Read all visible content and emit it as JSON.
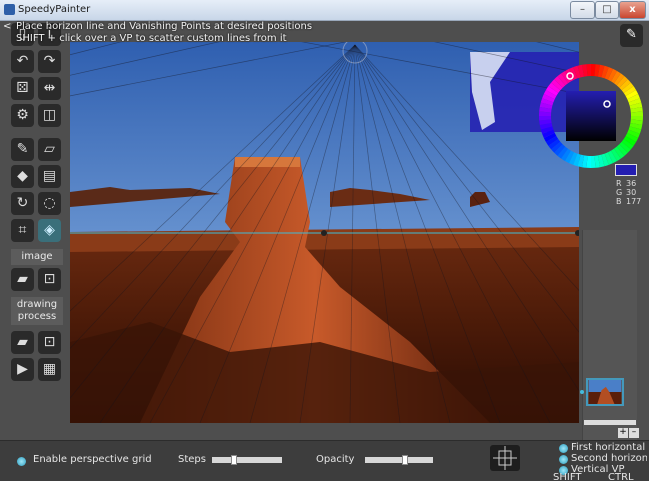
{
  "window": {
    "title": "SpeedyPainter",
    "minimize": "–",
    "maximize": "□",
    "close": "x"
  },
  "status": {
    "back": "<",
    "line1": "Place horizon line and Vanishing Points at desired positions",
    "line2": "SHIFT + click over a VP to scatter custom lines from it"
  },
  "toolbar": {
    "image_label": "image",
    "drawing_process_label": "drawing\nprocess",
    "icons": [
      "new-document-icon",
      "info-icon",
      "undo-icon",
      "redo-icon",
      "dice-icon",
      "mirror-icon",
      "settings-icon",
      "split-view-icon",
      "brush-icon",
      "eraser-icon",
      "fill-icon",
      "gradient-icon",
      "rotate-icon",
      "lasso-icon",
      "crop-icon",
      "perspective-icon",
      "open-folder-icon",
      "save-icon",
      "open-folder-icon",
      "save-icon",
      "play-icon",
      "clapperboard-icon"
    ]
  },
  "color": {
    "r": "36",
    "g": "30",
    "b": "177",
    "r_label": "R",
    "g_label": "G",
    "b_label": "B",
    "swatch": "#241eb1"
  },
  "layers": {
    "add": "+",
    "remove": "–"
  },
  "bottom": {
    "enable_grid": "Enable perspective grid",
    "steps_label": "Steps",
    "steps_value": 0.3,
    "opacity_label": "Opacity",
    "opacity_value": 0.6,
    "vp_first": "First horizontal VP",
    "vp_second": "Second horizontal VP",
    "vp_vertical": "Vertical VP",
    "shift_hint": "SHIFT",
    "ctrl_hint": "CTRL"
  }
}
